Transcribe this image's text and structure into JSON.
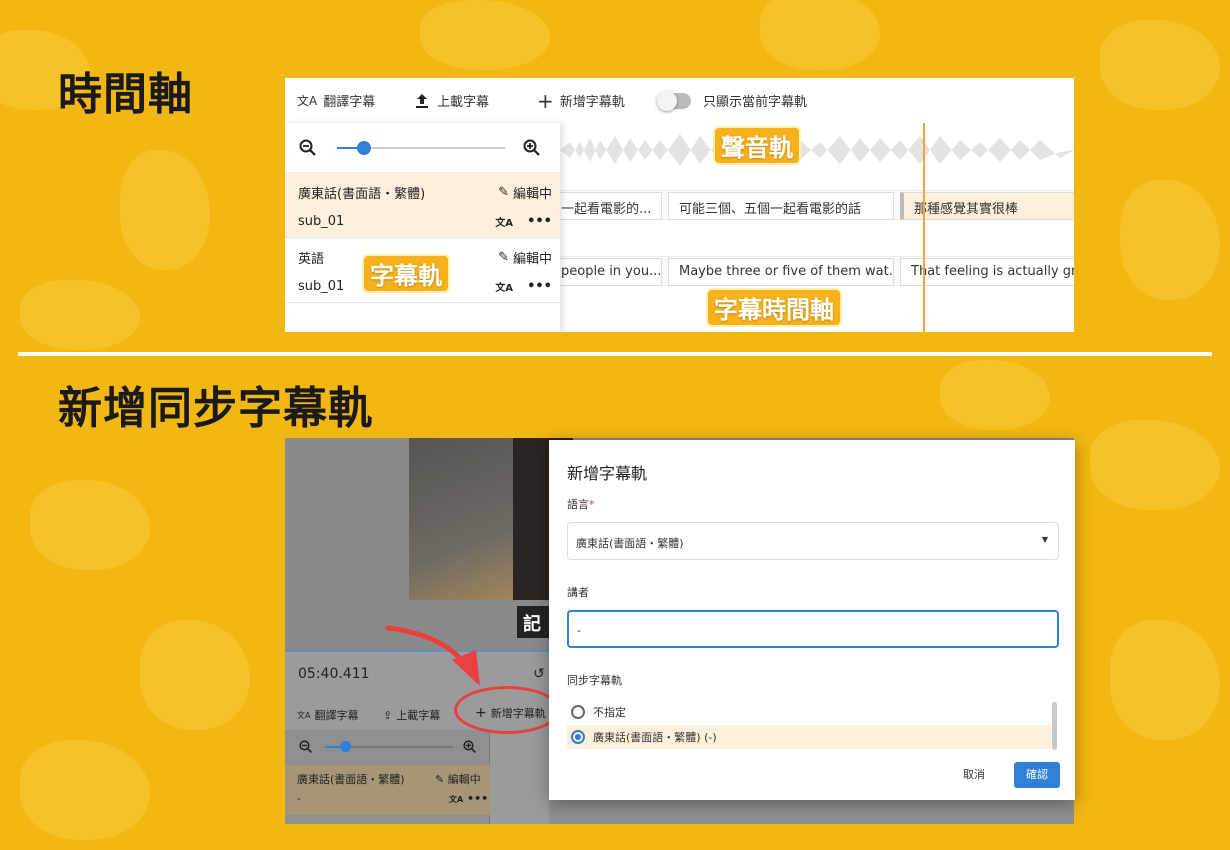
{
  "headings": {
    "timeline": "時間軸",
    "add_sync": "新增同步字幕軌"
  },
  "top_panel": {
    "toolbar": {
      "translate": "翻譯字幕",
      "upload": "上載字幕",
      "add_track": "新增字幕軌",
      "toggle_label": "只顯示當前字幕軌"
    },
    "tracks": [
      {
        "language": "廣東話(書面語・繁體)",
        "status": "編輯中",
        "name": "sub_01"
      },
      {
        "language": "英語",
        "status": "編輯中",
        "name": "sub_01"
      }
    ],
    "cues_row1": [
      "一起看電影的...",
      "可能三個、五個一起看電影的話",
      "那種感覺其實很棒"
    ],
    "cues_row2": [
      "people in you...",
      "Maybe three or five of them wat...",
      "That feeling is actually gre"
    ],
    "tags": {
      "audio": "聲音軌",
      "subtitle": "字幕軌",
      "timeline": "字幕時間軸"
    }
  },
  "bottom_panel": {
    "video_subtitle": "記",
    "time": "05:40.411",
    "toolbar": {
      "translate": "翻譯字幕",
      "upload": "上載字幕",
      "add_track": "新增字幕軌"
    },
    "track": {
      "language": "廣東話(書面語・繁體)",
      "status": "編輯中",
      "name": "-"
    }
  },
  "modal": {
    "title": "新增字幕軌",
    "language_label": "語言",
    "required_mark": "*",
    "language_value": "廣東話(書面語・繁體)",
    "speaker_label": "講者",
    "speaker_value": "-",
    "sync_label": "同步字幕軌",
    "options": [
      "不指定",
      "廣東話(書面語・繁體) (-)"
    ],
    "selected_option": 1,
    "cancel": "取消",
    "confirm": "確認"
  },
  "colors": {
    "background": "#F2B713",
    "accent": "#2F80D8",
    "playhead": "#F4A340",
    "highlight": "#E8403F"
  }
}
